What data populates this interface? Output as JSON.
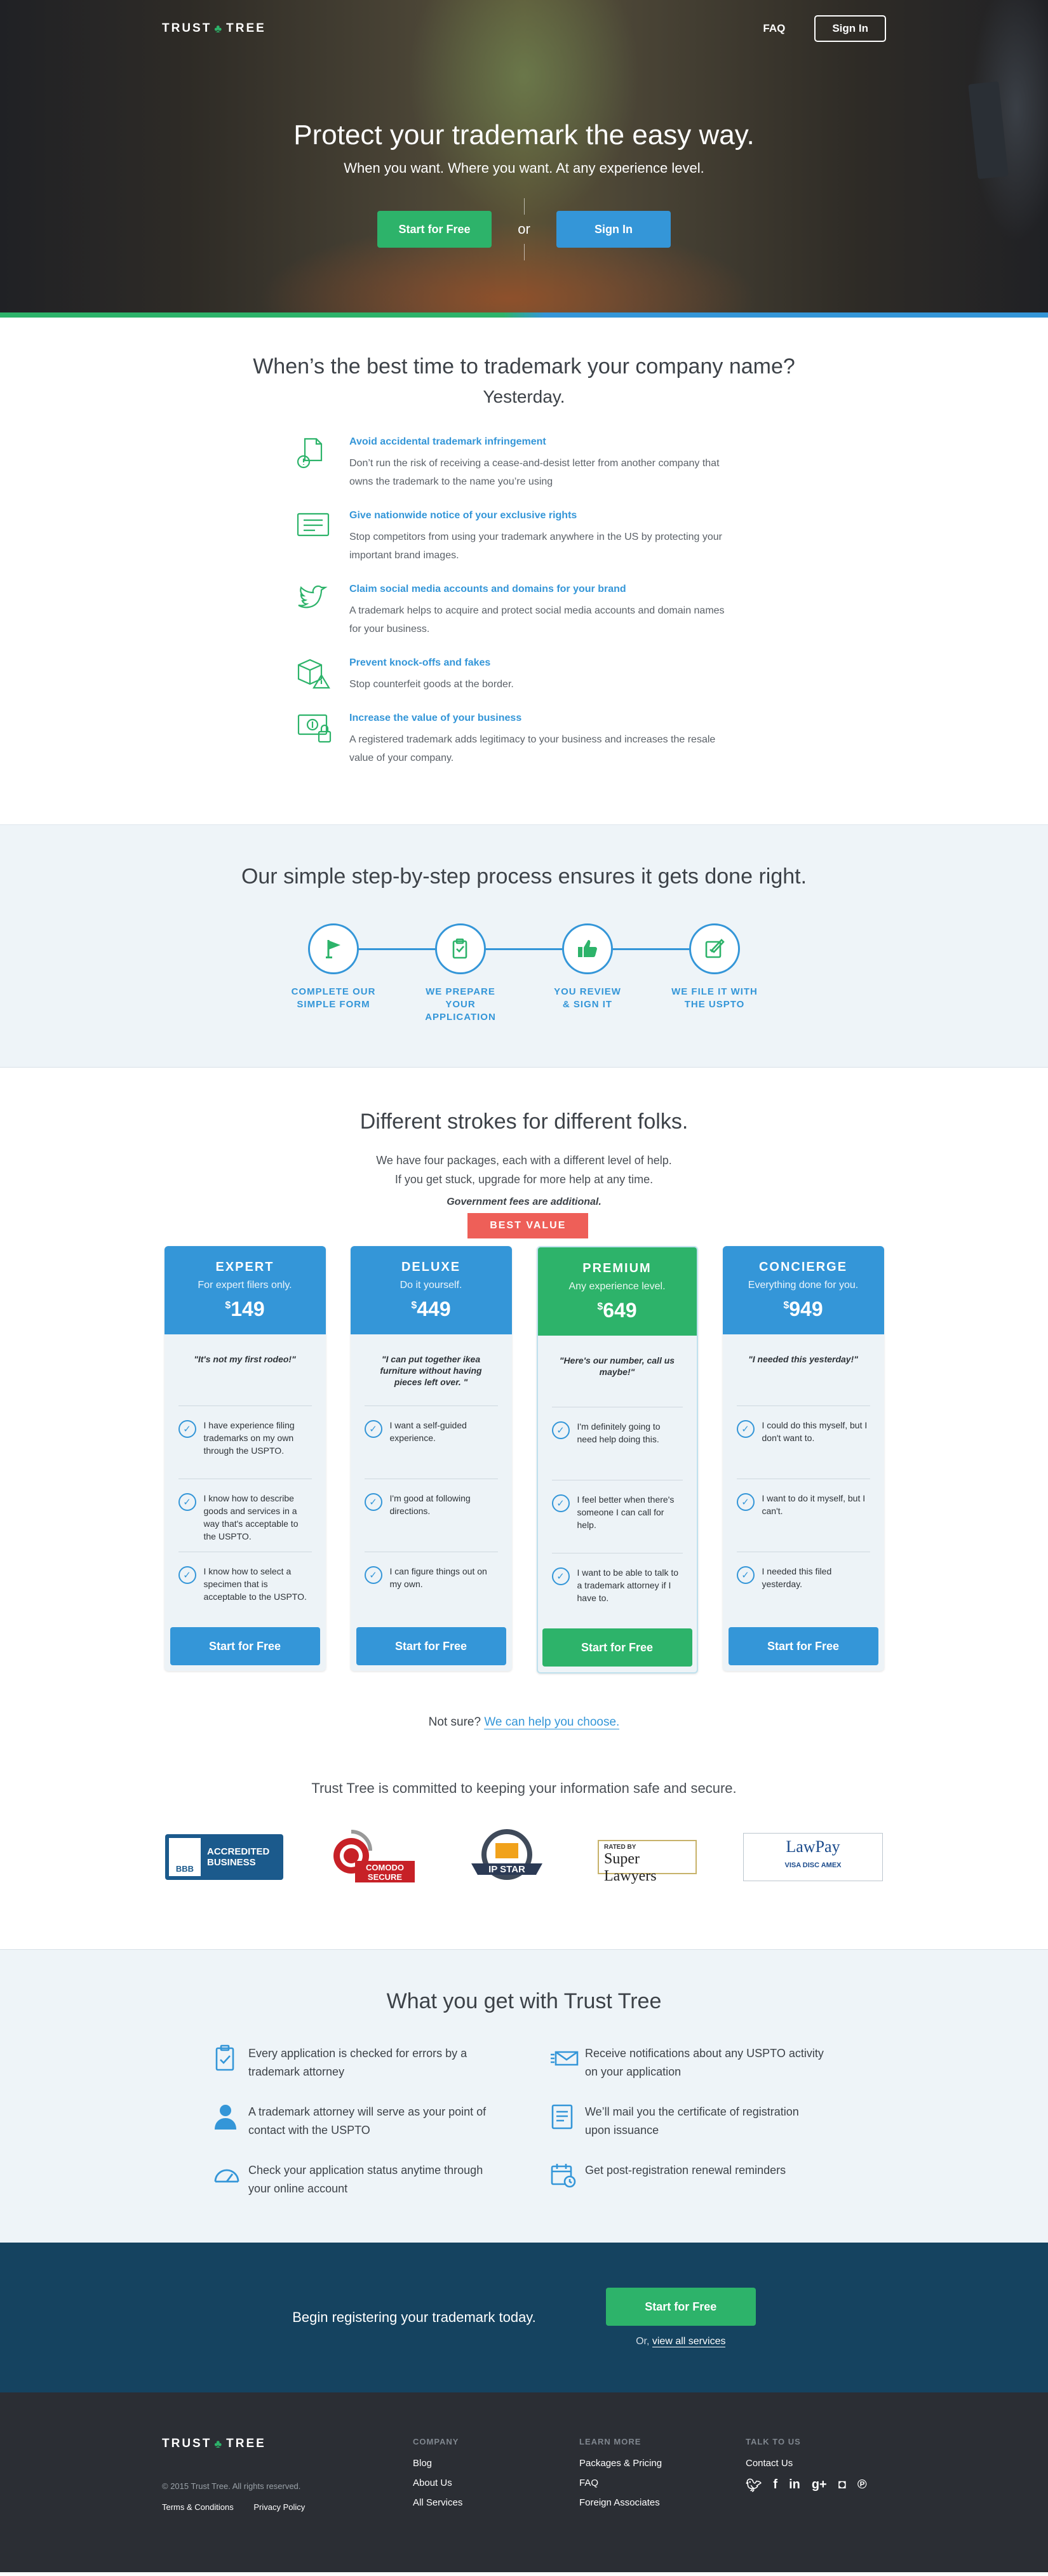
{
  "nav": {
    "logo_left": "TRUST",
    "logo_right": "TREE",
    "faq": "FAQ",
    "signin": "Sign In"
  },
  "hero": {
    "title": "Protect your trademark the easy way.",
    "subtitle": "When you want. Where you want. At any experience level.",
    "start": "Start for Free",
    "or": "or",
    "signin": "Sign In"
  },
  "benefits": {
    "title": "When’s the best time to trademark your company name?",
    "answer": "Yesterday.",
    "items": [
      {
        "title": "Avoid accidental trademark infringement",
        "text": "Don’t run the risk of receiving a cease-and-desist letter from another company that owns the trademark to the name you’re using",
        "icon": "document-warning-icon"
      },
      {
        "title": "Give nationwide notice of your exclusive rights",
        "text": "Stop competitors from using your trademark anywhere in the US by protecting your important brand images.",
        "icon": "certificate-icon"
      },
      {
        "title": "Claim social media accounts and domains for your brand",
        "text": "A trademark helps to acquire and protect social media accounts and domain names for your business.",
        "icon": "bird-icon"
      },
      {
        "title": "Prevent knock-offs and fakes",
        "text": "Stop counterfeit goods at the border.",
        "icon": "box-warning-icon"
      },
      {
        "title": "Increase the value of your business",
        "text": "A registered trademark adds legitimacy to your business and increases the resale value of your company.",
        "icon": "money-lock-icon"
      }
    ]
  },
  "process": {
    "title": "Our simple step-by-step process ensures it gets done right.",
    "steps": [
      {
        "line1": "COMPLETE OUR",
        "line2": "SIMPLE FORM",
        "icon": "flag-icon"
      },
      {
        "line1": "WE PREPARE",
        "line2": "YOUR APPLICATION",
        "icon": "clipboard-icon"
      },
      {
        "line1": "YOU REVIEW",
        "line2": "& SIGN IT",
        "icon": "thumbs-up-icon"
      },
      {
        "line1": "WE FILE IT WITH",
        "line2": "THE USPTO",
        "icon": "edit-icon"
      }
    ]
  },
  "packages": {
    "title": "Different strokes for different folks.",
    "desc1": "We have four packages, each with a different level of help.",
    "desc2": "If you get stuck, upgrade for more help at any time.",
    "fees": "Government fees are additional.",
    "best_value": "BEST VALUE",
    "button": "Start for Free",
    "cards": [
      {
        "name": "EXPERT",
        "tagline": "For expert filers only.",
        "currency": "$",
        "price": "149",
        "quote": "\"It's not my first rodeo!\"",
        "features": [
          "I have experience filing trademarks on my own through the USPTO.",
          "I know how to describe goods and services in a way that's acceptable to the USPTO.",
          "I know how to select a specimen that is acceptable to the USPTO."
        ]
      },
      {
        "name": "DELUXE",
        "tagline": "Do it yourself.",
        "currency": "$",
        "price": "449",
        "quote": "\"I can put together ikea furniture without having pieces left over. \"",
        "features": [
          "I want a self-guided experience.",
          "I'm good at following directions.",
          "I can figure things out on my own."
        ]
      },
      {
        "name": "PREMIUM",
        "tagline": "Any experience level.",
        "currency": "$",
        "price": "649",
        "quote": "\"Here's our number, call us maybe!\"",
        "features": [
          "I'm definitely going to need help doing this.",
          "I feel better when there's someone I can call for help.",
          "I want to be able to talk to a trademark attorney if I have to."
        ]
      },
      {
        "name": "CONCIERGE",
        "tagline": "Everything done for you.",
        "currency": "$",
        "price": "949",
        "quote": "\"I needed this yesterday!\"",
        "features": [
          "I could do this myself, but I don't want to.",
          "I want to do it myself, but I can't.",
          "I needed this filed yesterday."
        ]
      }
    ],
    "notsure": "Not sure?",
    "help_link": "We can help you choose."
  },
  "trust": {
    "title": "Trust Tree is committed to keeping your information safe and secure.",
    "bbb_line1": "ACCREDITED",
    "bbb_line2": "BUSINESS",
    "bbb_logo": "BBB",
    "comodo": "COMODO",
    "comodo_sub": "SECURE",
    "ipstar": "IP STAR",
    "sl_top": "RATED BY",
    "sl_name": "Super Lawyers",
    "lawpay": "LawPay",
    "lawpay_cards": "VISA  DISC  AMEX"
  },
  "get": {
    "title": "What you get with Trust Tree",
    "items": [
      {
        "text": "Every application is checked for errors by a trademark attorney",
        "icon": "clipboard-check-icon"
      },
      {
        "text": "Receive notifications about any USPTO activity on your application",
        "icon": "notification-icon"
      },
      {
        "text": "A trademark attorney will serve as your point of contact with the USPTO",
        "icon": "attorney-icon"
      },
      {
        "text": "We’ll mail you the certificate of registration upon issuance",
        "icon": "certificate-mail-icon"
      },
      {
        "text": "Check your application status anytime through your online account",
        "icon": "gauge-icon"
      },
      {
        "text": "Get post-registration renewal reminders",
        "icon": "calendar-icon"
      }
    ]
  },
  "begin": {
    "text": "Begin registering your trademark today.",
    "button": "Start for Free",
    "or": "Or,",
    "link": "view all services"
  },
  "footer": {
    "copyright": "© 2015 Trust Tree. All rights reserved.",
    "terms": "Terms & Conditions",
    "privacy": "Privacy Policy",
    "company": {
      "heading": "COMPANY",
      "links": [
        "Blog",
        "About Us",
        "All Services"
      ]
    },
    "learn": {
      "heading": "LEARN MORE",
      "links": [
        "Packages & Pricing",
        "FAQ",
        "Foreign Associates"
      ]
    },
    "talk": {
      "heading": "TALK TO US",
      "links": [
        "Contact Us"
      ]
    },
    "social": [
      "twitter-icon",
      "facebook-icon",
      "linkedin-icon",
      "google-plus-icon",
      "instagram-icon",
      "pinterest-icon"
    ]
  },
  "colors": {
    "green": "#2db36a",
    "blue": "#3496d8",
    "red": "#ee5f58",
    "navy": "#154360",
    "footer": "#2b2e34",
    "light": "#eef4f8"
  }
}
